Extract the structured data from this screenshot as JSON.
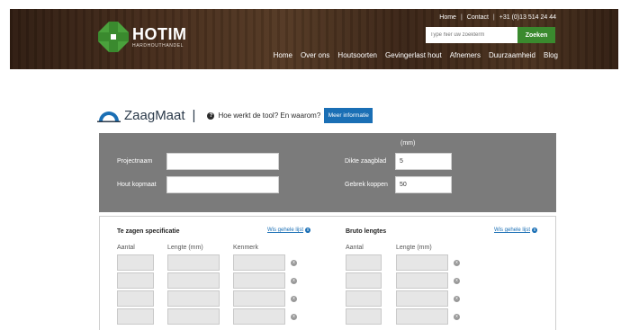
{
  "header": {
    "logo_name": "HOTIM",
    "logo_sub": "HARDHOUTHANDEL",
    "top_links": [
      "Home",
      "Contact",
      "+31 (0)13 514 24 44"
    ],
    "search_placeholder": "Type hier uw zoekterm",
    "search_button": "Zoeken",
    "nav": [
      "Home",
      "Over ons",
      "Houtsoorten",
      "Gevingerlast hout",
      "Afnemers",
      "Duurzaamheid",
      "Blog"
    ]
  },
  "tool": {
    "title": "ZaagMaat",
    "separator": "|",
    "help_text": "Hoe werkt de tool? En waarom?",
    "info_button": "Meer informatie"
  },
  "settings": {
    "unit": "(mm)",
    "project_label": "Projectnaam",
    "project_value": "",
    "kopmaat_label": "Hout kopmaat",
    "kopmaat_value": "",
    "dikte_label": "Dikte zaagblad",
    "dikte_value": "5",
    "gebrek_label": "Gebrek koppen",
    "gebrek_value": "50"
  },
  "spec": {
    "title": "Te zagen specificatie",
    "clear": "Wis gehele lijst",
    "columns": [
      "Aantal",
      "Lengte (mm)",
      "Kenmerk"
    ]
  },
  "bruto": {
    "title": "Bruto lengtes",
    "clear": "Wis gehele lijst",
    "columns": [
      "Aantal",
      "Lengte (mm)"
    ]
  },
  "icons": {
    "delete": "x",
    "clear": "x",
    "help": "?"
  },
  "colors": {
    "accent_green": "#3a8a2e",
    "accent_blue": "#1a6fb5",
    "panel_grey": "#7b7b7b"
  }
}
